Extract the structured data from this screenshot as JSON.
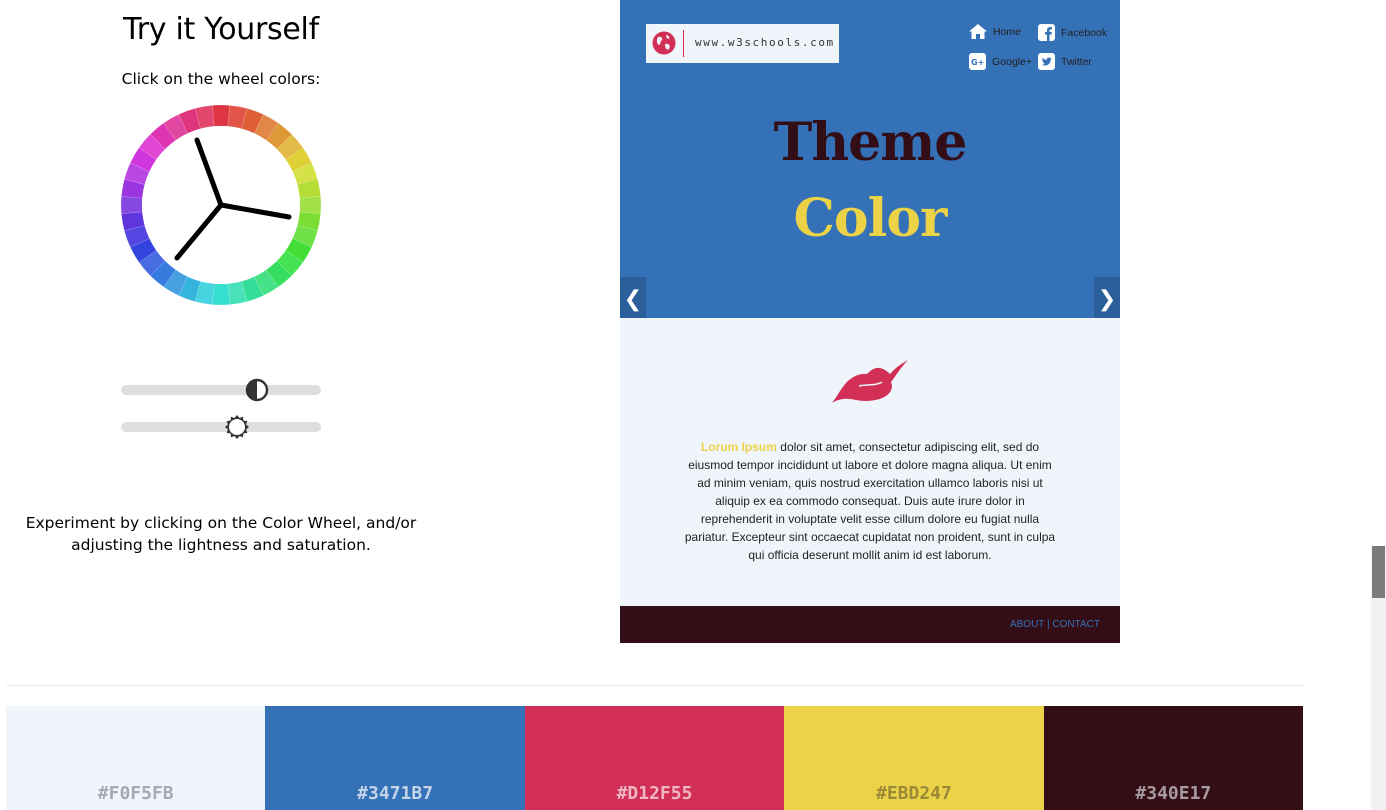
{
  "left": {
    "title": "Try it Yourself",
    "wheel_instructions": "Click on the wheel colors:",
    "experiment_text": "Experiment by clicking on the Color Wheel, and/or adjusting the lightness and saturation.",
    "lightness_fraction": 0.68,
    "saturation_fraction": 0.58
  },
  "preview": {
    "logo_text": "www.w3schools.com",
    "nav": {
      "home": "Home",
      "facebook": "Facebook",
      "google": "Google+",
      "twitter": "Twitter"
    },
    "hero_line1": "Theme",
    "hero_line2": "Color",
    "prev_arrow": "❮",
    "next_arrow": "❯",
    "lorem_accent": "Lorum Ipsum",
    "lorem_body": " dolor sit amet, consectetur adipiscing elit, sed do eiusmod tempor incididunt ut labore et dolore magna aliqua. Ut enim ad minim veniam, quis nostrud exercitation ullamco laboris nisi ut aliquip ex ea commodo consequat. Duis aute irure dolor in reprehenderit in voluptate velit esse cillum dolore eu fugiat nulla pariatur. Excepteur sint occaecat cupidatat non proident, sunt in culpa qui officia deserunt mollit anim id est laborum.",
    "footer_about": "ABOUT",
    "footer_sep": " | ",
    "footer_contact": "CONTACT"
  },
  "palette": [
    {
      "hex": "#F0F5FB",
      "label": "#F0F5FB",
      "text_color": "#a3aab3"
    },
    {
      "hex": "#3471B7",
      "label": "#3471B7",
      "text_color": "#c4d5ea"
    },
    {
      "hex": "#D12F55",
      "label": "#D12F55",
      "text_color": "#f0b6c3"
    },
    {
      "hex": "#EBD247",
      "label": "#EBD247",
      "text_color": "#9a8a38"
    },
    {
      "hex": "#340E17",
      "label": "#340E17",
      "text_color": "#a89ba0"
    }
  ]
}
